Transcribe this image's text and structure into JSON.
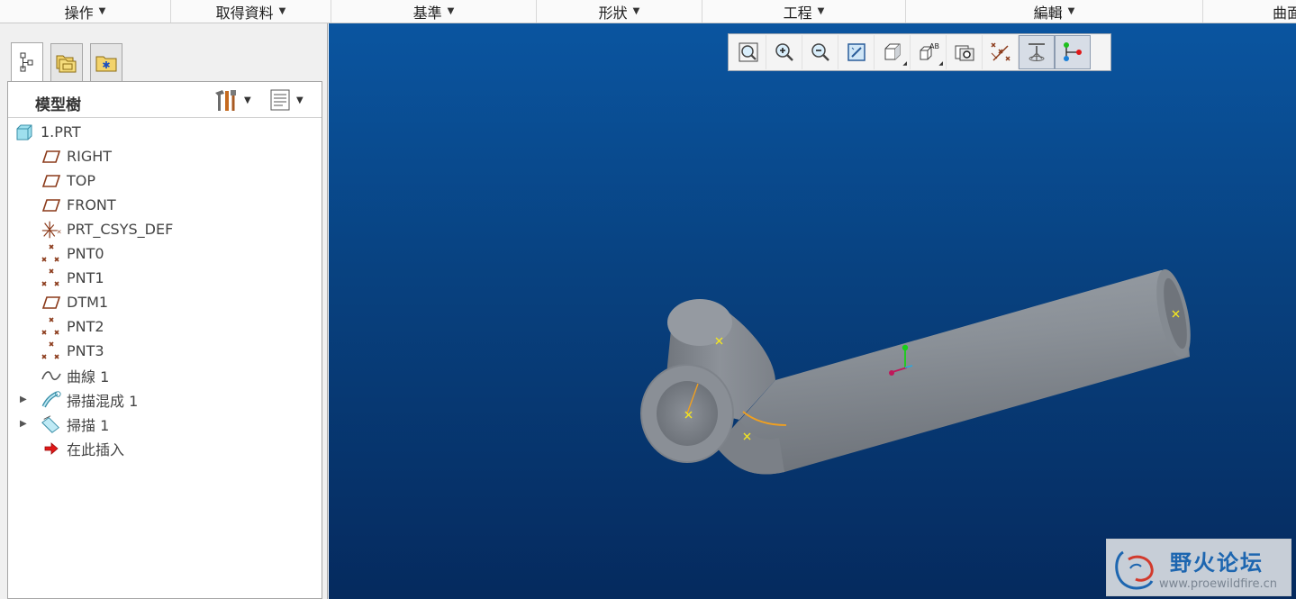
{
  "menubar": {
    "items": [
      {
        "label": "操作"
      },
      {
        "label": "取得資料"
      },
      {
        "label": "基準"
      },
      {
        "label": "形狀"
      },
      {
        "label": "工程"
      },
      {
        "label": "編輯"
      },
      {
        "label": "曲面"
      }
    ]
  },
  "left_panel": {
    "tabs": [
      {
        "icon": "model-tree-icon",
        "active": true
      },
      {
        "icon": "folder-browser-icon",
        "active": false
      },
      {
        "icon": "favorites-icon",
        "active": false
      }
    ],
    "tree_title": "模型樹",
    "settings_icon": "tools-icon",
    "show_icon": "list-settings-icon",
    "tree_items": [
      {
        "label": "1.PRT",
        "icon": "part-icon",
        "expander": ""
      },
      {
        "label": "RIGHT",
        "icon": "datum-plane-icon",
        "expander": ""
      },
      {
        "label": "TOP",
        "icon": "datum-plane-icon",
        "expander": ""
      },
      {
        "label": "FRONT",
        "icon": "datum-plane-icon",
        "expander": ""
      },
      {
        "label": "PRT_CSYS_DEF",
        "icon": "csys-icon",
        "expander": ""
      },
      {
        "label": "PNT0",
        "icon": "datum-point-icon",
        "expander": ""
      },
      {
        "label": "PNT1",
        "icon": "datum-point-icon",
        "expander": ""
      },
      {
        "label": "DTM1",
        "icon": "datum-plane-icon",
        "expander": ""
      },
      {
        "label": "PNT2",
        "icon": "datum-point-icon",
        "expander": ""
      },
      {
        "label": "PNT3",
        "icon": "datum-point-icon",
        "expander": ""
      },
      {
        "label": "曲線 1",
        "icon": "curve-icon",
        "expander": ""
      },
      {
        "label": "掃描混成 1",
        "icon": "swept-blend-icon",
        "expander": "▶"
      },
      {
        "label": "掃描 1",
        "icon": "sweep-icon",
        "expander": "▶"
      },
      {
        "label": "在此插入",
        "icon": "insert-here-icon",
        "expander": ""
      }
    ]
  },
  "view_toolbar": {
    "buttons": [
      {
        "icon": "refit-icon"
      },
      {
        "icon": "zoom-in-icon"
      },
      {
        "icon": "zoom-out-icon"
      },
      {
        "icon": "repaint-icon"
      },
      {
        "icon": "display-style-icon"
      },
      {
        "icon": "saved-orientations-icon"
      },
      {
        "icon": "view-manager-icon"
      },
      {
        "icon": "datum-display-filters-icon"
      },
      {
        "icon": "spin-center-icon"
      },
      {
        "icon": "annotation-display-icon"
      }
    ]
  },
  "watermark": {
    "title": "野火论坛",
    "url": "www.proewildfire.cn"
  },
  "colors": {
    "viewport_top": "#0a55a0",
    "viewport_bottom": "#052a5e",
    "model_gray": "#8a8f96",
    "datum_point": "#f4e61f",
    "curve": "#f0a020",
    "tree_icon_brown": "#8b3a1a"
  }
}
